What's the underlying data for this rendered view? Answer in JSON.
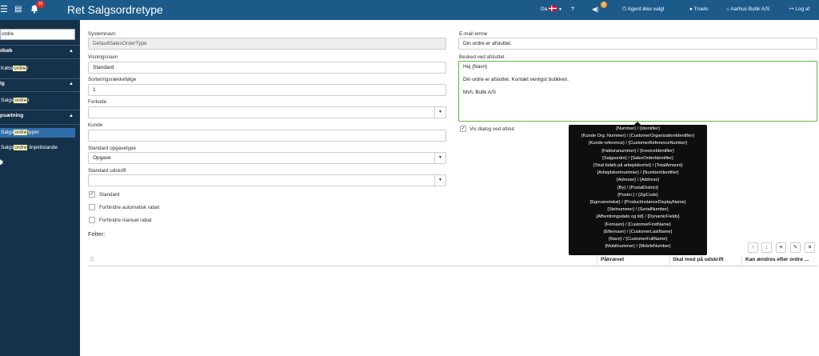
{
  "topbar": {
    "notifications_count": "16",
    "title": "Ret Salgsordretype",
    "language": "Da",
    "volume_count": "0",
    "agent": "Agent ikke valgt",
    "user": "Troels",
    "store": "Aarhus Butik A/S",
    "logout": "Log af"
  },
  "sidebar": {
    "search_value": "ordre",
    "sections": [
      {
        "label": "dkøb",
        "items": [
          {
            "prefix": "Købs",
            "match": "ordre",
            "suffix": "r"
          }
        ]
      },
      {
        "label": "lg",
        "items": [
          {
            "prefix": "Salgs",
            "match": "ordre",
            "suffix": "r"
          }
        ]
      },
      {
        "label": "psætning",
        "items": [
          {
            "prefix": "Salgs",
            "match": "ordre",
            "suffix": "typer",
            "active": true
          },
          {
            "prefix": "Salgs",
            "match": "ordre",
            "suffix": " linjetilstande"
          }
        ]
      }
    ]
  },
  "form": {
    "systemnavn_label": "Systemnavn",
    "systemnavn_value": "DefaultSalesOrderType",
    "visningsnavn_label": "Visningsnavn",
    "visningsnavn_value": "Standard",
    "sortering_label": "Sorteringsrækkefølge",
    "sortering_value": "1",
    "forkode_label": "Forkode",
    "forkode_value": "",
    "kunde_label": "Kunde",
    "kunde_value": "",
    "opgavetype_label": "Standard opgavetype",
    "opgavetype_value": "Opgave",
    "udskrift_label": "Standard udskrift",
    "udskrift_value": "",
    "checkbox_standard": "Standard",
    "checkbox_auto_rabat": "Forhindre automatisk rabat",
    "checkbox_manuel_rabat": "Forhindre manuel rabat",
    "felter_label": "Felter:",
    "email_label": "E-mail emne",
    "email_value": "Din ordre er afsluttet.",
    "besked_label": "Besked ved afsluttet",
    "besked_lines": [
      "Hej {Navn}",
      "",
      "Din ordre er afsluttet. Kontakt venligst butikken.",
      "",
      "Mvh. Butik A/S"
    ],
    "vis_dialog_label": "Vis dialog ved afslut"
  },
  "tooltip_lines": [
    "{Nummer} / {Identifier}",
    "{Kunde Org. Nummer} / {CustomerOrganizationIdentifier}",
    "{Kunde reference} / {CustomerReferenceNumber}",
    "{Fakturanummer} / {InvoiceIdentifier}",
    "{Salgsordre} / {SalesOrderIdentifier}",
    "{Total beløb på arbejdskortet} / {TotalAmount}",
    "{Arbejdskortnummer} / {NumberIdentifier}",
    "{Adresse} / {Address}",
    "{By} / {PostalDistrict}",
    "{Postnr.} / {ZipCode}",
    "{Egovarertekst} / {ProductInstanceDisplayName}",
    "{Stelnummer} / {SerialNumber}",
    "{Afhentningsdato og tid} / {DynamicFields}",
    "{Fornavn} / {CustomerFirstName}",
    "{Efternavn} / {CustomerLastName}",
    "{Navn} / {CustomerFullName}",
    "{Mobilnummer} / {MobileNumber}"
  ],
  "grid": {
    "columns": [
      "Påkrævet",
      "Skal med på udskrift",
      "Kan ændres efter ordre ..."
    ]
  }
}
